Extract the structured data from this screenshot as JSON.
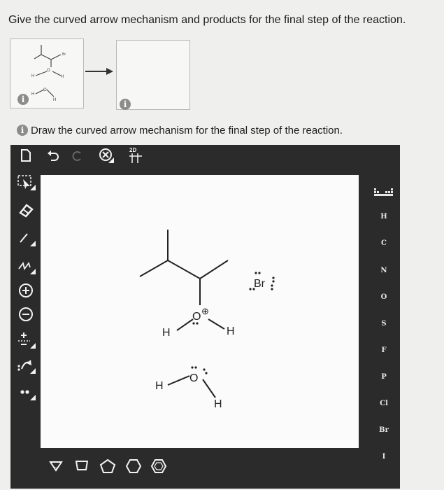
{
  "question": "Give the curved arrow mechanism and products for the final step of the reaction.",
  "instruction": "Draw the curved arrow mechanism for the final step of the reaction.",
  "info_glyph": "i",
  "toolbar": {
    "mode_badge": "2D",
    "icons": [
      "new-document-icon",
      "undo-icon",
      "redo-icon",
      "zoom-icon",
      "structure-2d-icon"
    ]
  },
  "left_tools": [
    "selection-tool-icon",
    "eraser-icon",
    "single-bond-icon",
    "chain-icon",
    "positive-charge-icon",
    "negative-charge-icon",
    "plus-minus-icon",
    "curved-arrow-icon",
    "lone-pair-icon"
  ],
  "periodic_table_icon": "periodic-table-icon",
  "elements": [
    "H",
    "C",
    "N",
    "O",
    "S",
    "F",
    "P",
    "Cl",
    "Br",
    "I"
  ],
  "shapes": [
    "cyclopropane-icon",
    "cyclobutane-icon",
    "cyclopentane-icon",
    "cyclohexane-icon",
    "benzene-icon"
  ],
  "molecule": {
    "atom_labels": {
      "bromide": "Br",
      "oxonium": "O",
      "water_oxygen": "O",
      "h_left": "H",
      "h_right": "H",
      "water_h_left": "H",
      "water_h_bottom": "H"
    },
    "charges": {
      "oxonium": "⊕",
      "bromide": "−"
    }
  }
}
